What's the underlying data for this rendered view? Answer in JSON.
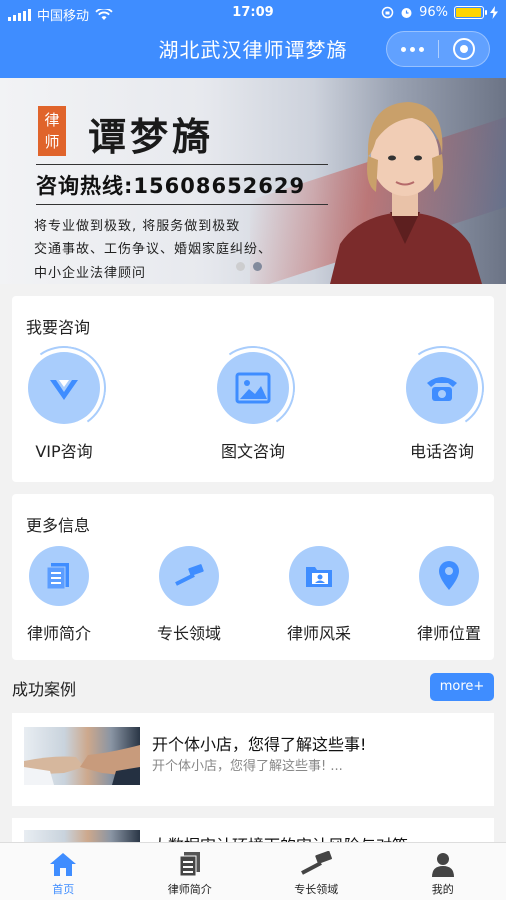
{
  "status_bar": {
    "carrier": "中国移动",
    "time": "17:09",
    "battery": "96%",
    "battery_level": 0.96
  },
  "nav": {
    "title": "湖北武汉律师谭梦旖"
  },
  "banner": {
    "badge": "律\n师",
    "name": "谭梦旖",
    "hotline": "咨询热线:15608652629",
    "lines": [
      "将专业做到极致, 将服务做到极致",
      "交通事故、工伤争议、婚姻家庭纠纷、",
      "中小企业法律顾问"
    ],
    "page_count": 2,
    "active_page": 1
  },
  "consult": {
    "title": "我要咨询",
    "items": [
      {
        "label": "VIP咨询",
        "icon": "vip-icon"
      },
      {
        "label": "图文咨询",
        "icon": "image-icon"
      },
      {
        "label": "电话咨询",
        "icon": "phone-icon"
      }
    ]
  },
  "more_info": {
    "title": "更多信息",
    "items": [
      {
        "label": "律师简介",
        "icon": "document-icon"
      },
      {
        "label": "专长领域",
        "icon": "gavel-icon"
      },
      {
        "label": "律师风采",
        "icon": "folder-photo-icon"
      },
      {
        "label": "律师位置",
        "icon": "location-pin-icon"
      }
    ]
  },
  "cases": {
    "title": "成功案例",
    "more_label": "more+",
    "items": [
      {
        "title": "开个体小店，您得了解这些事!",
        "summary": "开个体小店，您得了解这些事! ..."
      },
      {
        "title": "大数据审计环境下的审计风险与对策",
        "summary": ""
      }
    ]
  },
  "tabbar": {
    "active_index": 0,
    "items": [
      {
        "label": "首页",
        "icon": "home-icon"
      },
      {
        "label": "律师简介",
        "icon": "document-icon"
      },
      {
        "label": "专长领域",
        "icon": "gavel-icon"
      },
      {
        "label": "我的",
        "icon": "user-icon"
      }
    ]
  },
  "colors": {
    "primary": "#3f8dff",
    "icon_bg": "#a9cdfc",
    "badge": "#e0642b"
  }
}
